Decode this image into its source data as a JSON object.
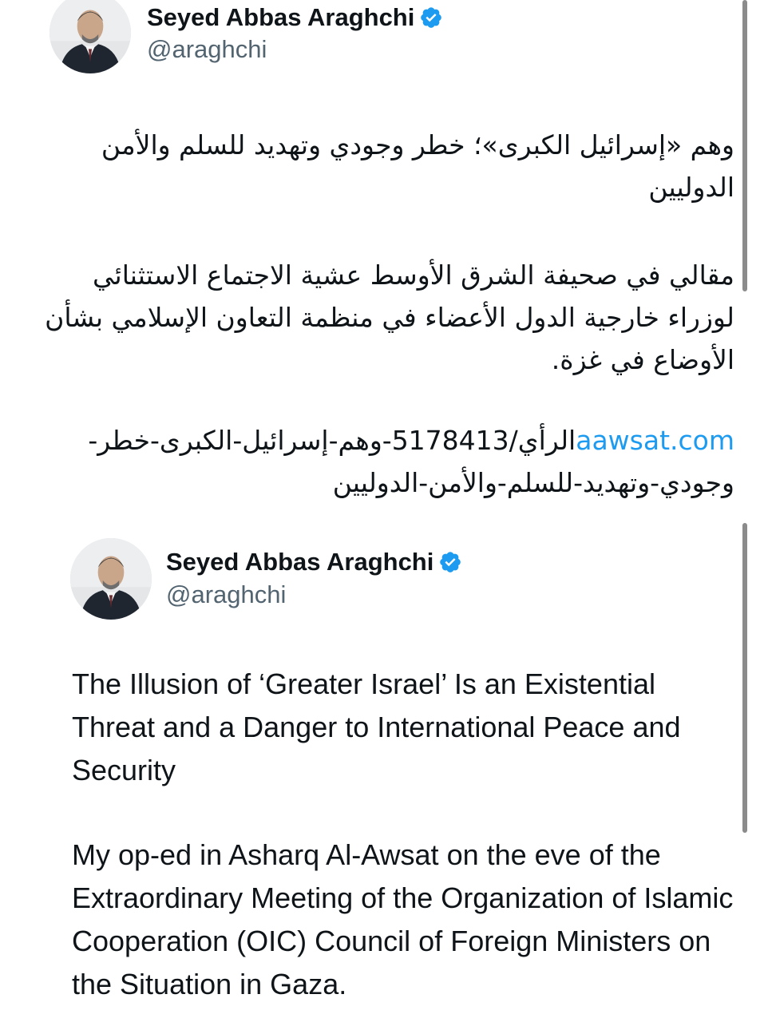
{
  "tweets": [
    {
      "author_name": "Seyed Abbas Araghchi",
      "handle": "@araghchi",
      "verified": true,
      "title": "وهم «إسرائيل الكبرى»؛ خطر وجودي وتهديد للسلم والأمن الدوليين",
      "body": "مقالي في صحيفة الشرق الأوسط عشية الاجتماع الاستثنائي لوزراء خارجية الدول الأعضاء في منظمة التعاون الإسلامي بشأن الأوضاع في غزة.",
      "link_domain": "aawsat.com",
      "link_path": "الرأي/5178413-وهم-إسرائيل-الكبرى-خطر-وجودي-وتهديد-للسلم-والأمن-الدوليين"
    },
    {
      "author_name": "Seyed Abbas Araghchi",
      "handle": "@araghchi",
      "verified": true,
      "title": "The Illusion of ‘Greater Israel’ Is an Existential Threat and a Danger to International Peace and Security",
      "body": "My op-ed in Asharq Al-Awsat on the eve of the Extraordinary Meeting of the Organization of Islamic Cooperation (OIC) Council of Foreign Ministers on the Situation in Gaza."
    }
  ],
  "colors": {
    "text": "#0f1419",
    "secondary": "#536471",
    "link": "#1d9bf0",
    "verified": "#1d9bf0",
    "scrollbar": "#8b8b8b"
  }
}
